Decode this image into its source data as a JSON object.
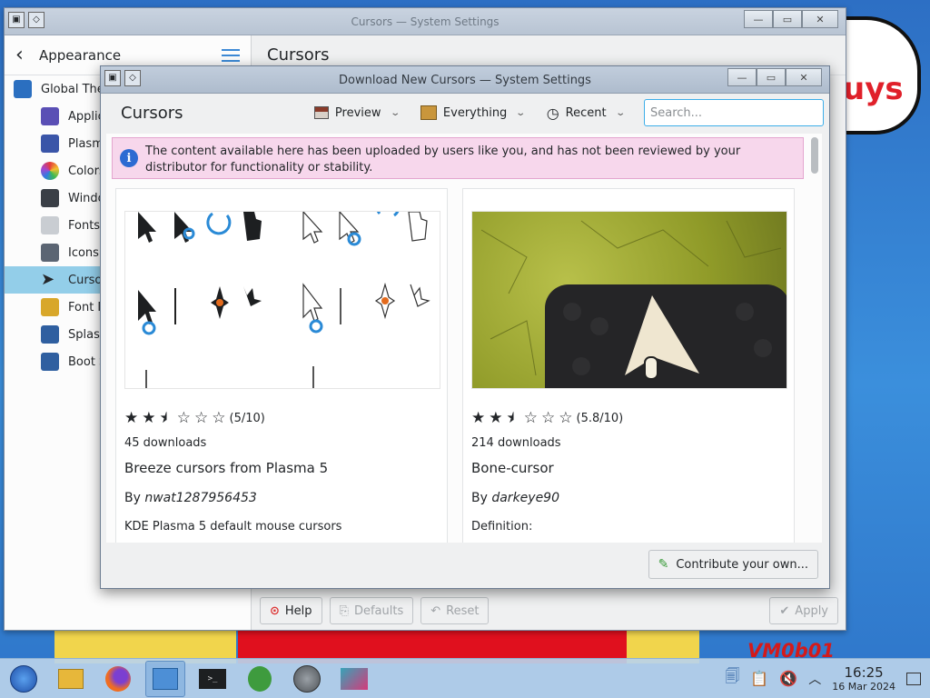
{
  "wallpaper": {
    "bubble_text": "uys",
    "corner_text": "VM0b01"
  },
  "bg_window": {
    "title": "Cursors — System Settings",
    "sidebar_title": "Appearance",
    "content_title": "Cursors",
    "sidebar_items": [
      {
        "label": "Global Theme",
        "icon": "global-theme-icon",
        "color": "#2b6fc0"
      },
      {
        "label": "Applica",
        "icon": "application-style-icon",
        "color": "#5a4fb5"
      },
      {
        "label": "Plasma",
        "icon": "plasma-style-icon",
        "color": "#3a55a8"
      },
      {
        "label": "Colors",
        "icon": "colors-icon",
        "color": "#e8a21e"
      },
      {
        "label": "Window",
        "icon": "window-decorations-icon",
        "color": "#3a3f46"
      },
      {
        "label": "Fonts",
        "icon": "fonts-icon",
        "color": "#7a8390"
      },
      {
        "label": "Icons",
        "icon": "icons-icon",
        "color": "#5b6573"
      },
      {
        "label": "Cursor",
        "icon": "cursor-icon",
        "color": "#ffffff"
      },
      {
        "label": "Font M",
        "icon": "font-management-icon",
        "color": "#d8a72a"
      },
      {
        "label": "Splash",
        "icon": "splash-screen-icon",
        "color": "#2f5fa0"
      },
      {
        "label": "Boot Sp",
        "icon": "boot-splash-icon",
        "color": "#2f5fa0"
      }
    ],
    "footer": {
      "help": "Help",
      "defaults": "Defaults",
      "reset": "Reset",
      "apply": "Apply"
    }
  },
  "dialog": {
    "title": "Download New Cursors — System Settings",
    "heading": "Cursors",
    "toolbar": {
      "preview": "Preview",
      "everything": "Everything",
      "recent": "Recent"
    },
    "search": {
      "placeholder": "Search...",
      "value": ""
    },
    "notice": "The content available here has been uploaded by users like you, and has not been reviewed by your distributor for functionality or stability.",
    "cards": [
      {
        "rating_text": "(5/10)",
        "rating": 5,
        "downloads": "45 downloads",
        "title": "Breeze cursors from Plasma 5",
        "by": "By",
        "author": "nwat1287956453",
        "description": "KDE Plasma 5 default mouse cursors"
      },
      {
        "rating_text": "(5.8/10)",
        "rating": 5.8,
        "downloads": "214 downloads",
        "title": "Bone-cursor",
        "by": "By",
        "author": "darkeye90",
        "description": "Definition:"
      }
    ],
    "contribute": "Contribute your own..."
  },
  "taskbar": {
    "apps": [
      {
        "name": "start-menu-icon",
        "color": "#2a62c8"
      },
      {
        "name": "file-manager-icon",
        "color": "#e7b73a"
      },
      {
        "name": "firefox-icon",
        "color": "#ef6d22"
      },
      {
        "name": "system-settings-icon",
        "color": "#4d8fd6"
      },
      {
        "name": "terminal-icon",
        "color": "#1d1f21"
      },
      {
        "name": "kde-connect-icon",
        "color": "#3e9b3e"
      },
      {
        "name": "clock-app-icon",
        "color": "#666a70"
      },
      {
        "name": "discover-icon",
        "color": "#36a4b8"
      }
    ],
    "time": "16:25",
    "date": "16 Mar 2024"
  }
}
